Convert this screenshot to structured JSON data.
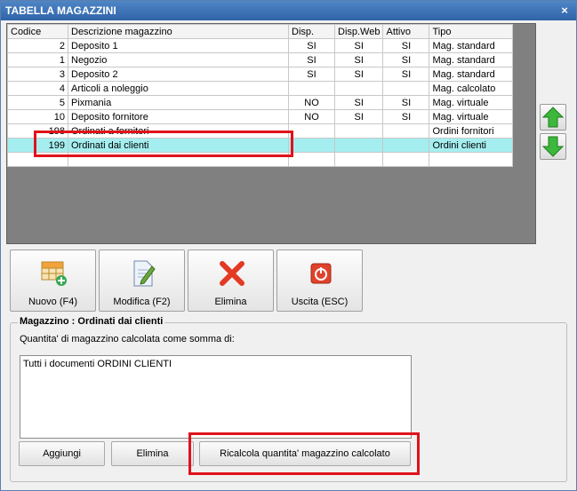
{
  "window": {
    "title": "TABELLA MAGAZZINI",
    "close_glyph": "×"
  },
  "grid": {
    "columns": [
      "Codice",
      "Descrizione magazzino",
      "Disp.",
      "Disp.Web",
      "Attivo",
      "Tipo"
    ],
    "rows": [
      {
        "code": "2",
        "desc": "Deposito 1",
        "disp": "SI",
        "web": "SI",
        "active": "SI",
        "type": "Mag. standard"
      },
      {
        "code": "1",
        "desc": "Negozio",
        "disp": "SI",
        "web": "SI",
        "active": "SI",
        "type": "Mag. standard"
      },
      {
        "code": "3",
        "desc": "Deposito 2",
        "disp": "SI",
        "web": "SI",
        "active": "SI",
        "type": "Mag. standard"
      },
      {
        "code": "4",
        "desc": "Articoli a noleggio",
        "disp": "",
        "web": "",
        "active": "",
        "type": "Mag. calcolato"
      },
      {
        "code": "5",
        "desc": "Pixmania",
        "disp": "NO",
        "web": "SI",
        "active": "SI",
        "type": "Mag. virtuale"
      },
      {
        "code": "10",
        "desc": "Deposito fornitore",
        "disp": "NO",
        "web": "SI",
        "active": "SI",
        "type": "Mag. virtuale"
      },
      {
        "code": "198",
        "desc": "Ordinati a fornitori",
        "disp": "",
        "web": "",
        "active": "",
        "type": "Ordini fornitori"
      },
      {
        "code": "199",
        "desc": "Ordinati dai clienti",
        "disp": "",
        "web": "",
        "active": "",
        "type": "Ordini clienti"
      },
      {
        "code": "",
        "desc": "",
        "disp": "",
        "web": "",
        "active": "",
        "type": ""
      }
    ],
    "selected_index": 7
  },
  "toolbar": {
    "new_label": "Nuovo (F4)",
    "edit_label": "Modifica (F2)",
    "delete_label": "Elimina",
    "exit_label": "Uscita (ESC)"
  },
  "detail": {
    "title": "Magazzino : Ordinati dai clienti",
    "subtitle": "Quantita' di magazzino calcolata come somma di:",
    "memo_text": "Tutti i documenti ORDINI CLIENTI",
    "add_label": "Aggiungi",
    "remove_label": "Elimina",
    "recalc_label": "Ricalcola quantita' magazzino calcolato"
  },
  "colors": {
    "selection": "#a5eef0",
    "annotation": "#e0121b",
    "title_bar": "#2f64a8"
  }
}
